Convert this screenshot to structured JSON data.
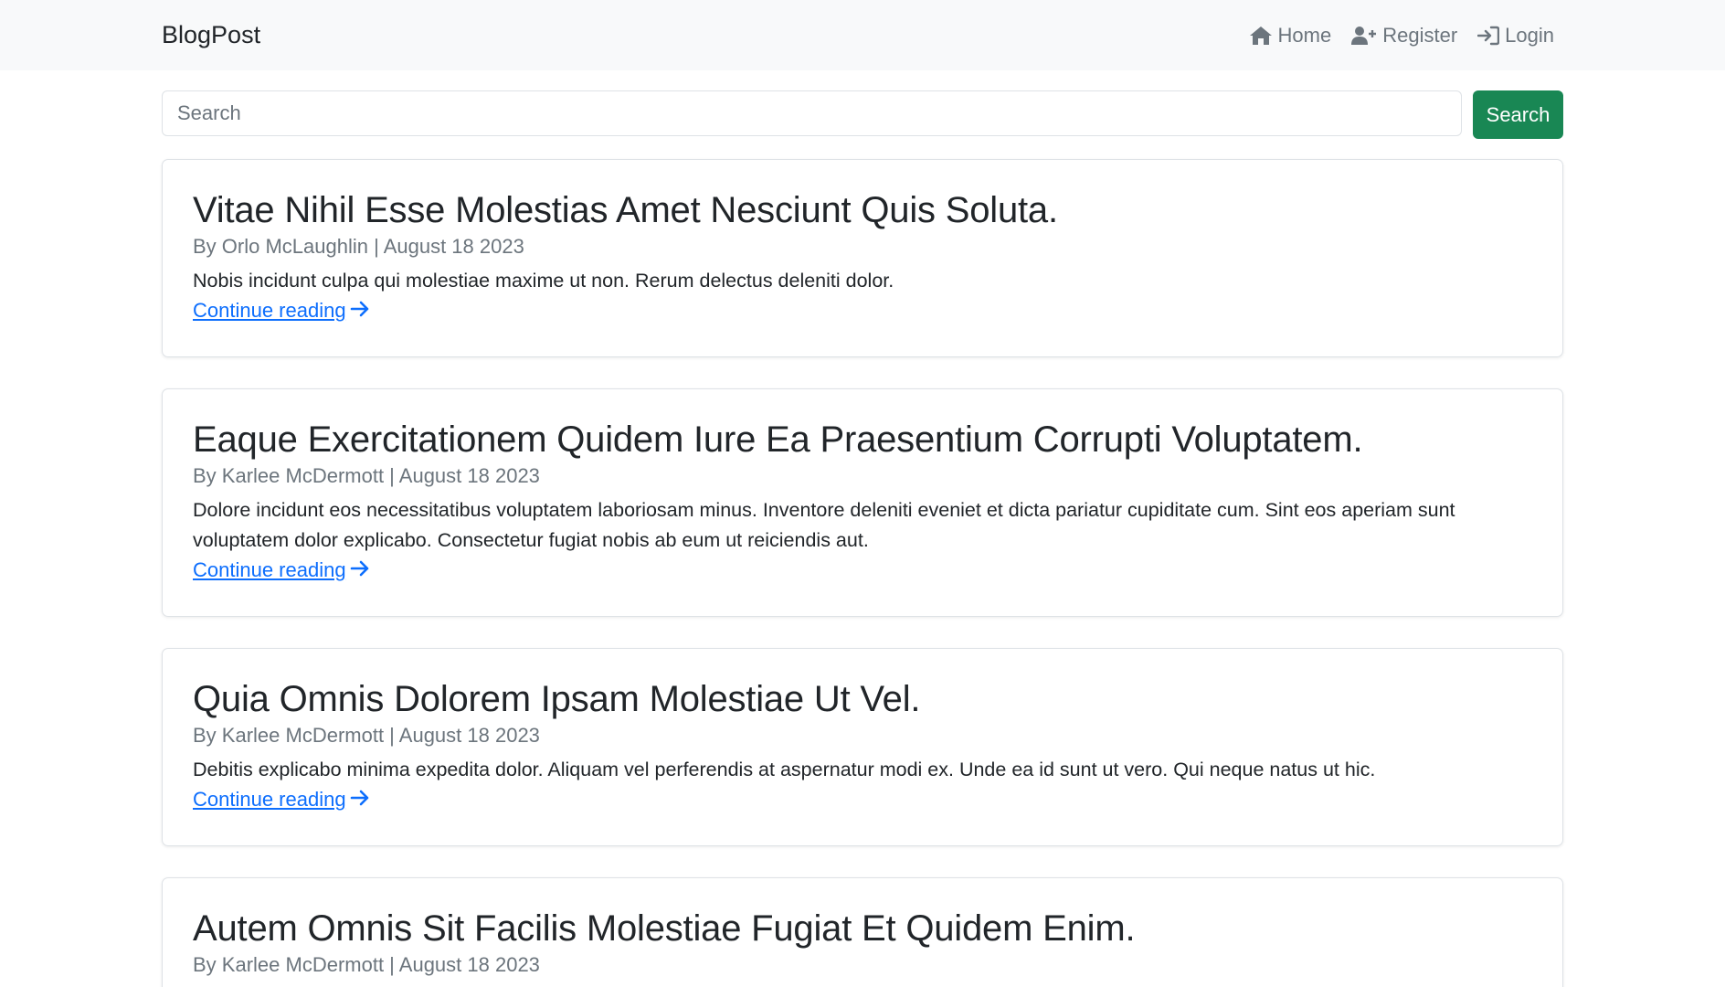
{
  "navbar": {
    "brand": "BlogPost",
    "links": [
      {
        "label": "Home",
        "icon": "home-icon"
      },
      {
        "label": "Register",
        "icon": "user-plus-icon"
      },
      {
        "label": "Login",
        "icon": "login-icon"
      }
    ]
  },
  "search": {
    "placeholder": "Search",
    "button_label": "Search"
  },
  "posts": [
    {
      "title": "Vitae Nihil Esse Molestias Amet Nesciunt Quis Soluta.",
      "meta": "By Orlo McLaughlin | August 18 2023",
      "excerpt": "Nobis incidunt culpa qui molestiae maxime ut non. Rerum delectus deleniti dolor.",
      "link_label": "Continue reading"
    },
    {
      "title": "Eaque Exercitationem Quidem Iure Ea Praesentium Corrupti Voluptatem.",
      "meta": "By Karlee McDermott | August 18 2023",
      "excerpt": "Dolore incidunt eos necessitatibus voluptatem laboriosam minus. Inventore deleniti eveniet et dicta pariatur cupiditate cum. Sint eos aperiam sunt voluptatem dolor explicabo. Consectetur fugiat nobis ab eum ut reiciendis aut.",
      "link_label": "Continue reading"
    },
    {
      "title": "Quia Omnis Dolorem Ipsam Molestiae Ut Vel.",
      "meta": "By Karlee McDermott | August 18 2023",
      "excerpt": "Debitis explicabo minima expedita dolor. Aliquam vel perferendis at aspernatur modi ex. Unde ea id sunt ut vero. Qui neque natus ut hic.",
      "link_label": "Continue reading"
    },
    {
      "title": "Autem Omnis Sit Facilis Molestiae Fugiat Et Quidem Enim.",
      "meta": "By Karlee McDermott | August 18 2023"
    }
  ],
  "colors": {
    "navbar_bg": "#f8f9fa",
    "search_button": "#198754",
    "link": "#0d6efd",
    "muted": "#6c757d"
  }
}
